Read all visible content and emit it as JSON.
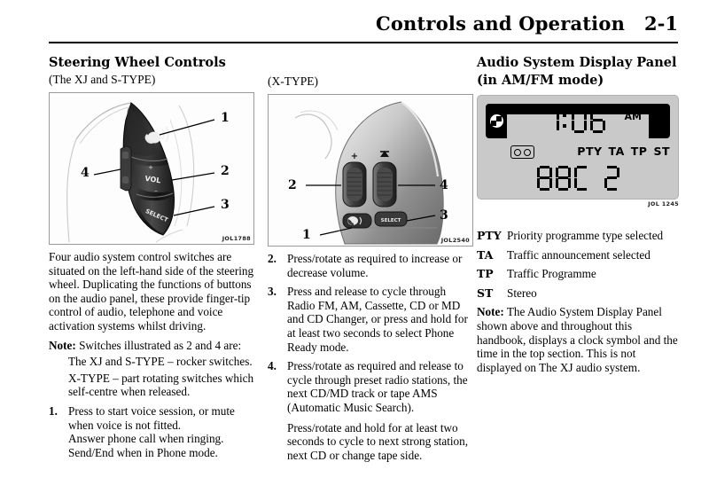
{
  "header": {
    "title": "Controls and Operation",
    "page": "2-1"
  },
  "left": {
    "section_title": "Steering Wheel Controls",
    "subtitle": "(The XJ and S-TYPE)",
    "figure": {
      "caption": "JOL1788",
      "callouts": [
        "1",
        "2",
        "3",
        "4"
      ],
      "button_labels": [
        "VOL",
        "SELECT"
      ]
    },
    "paragraph": "Four audio system control switches are situated on the left-hand side of the steering wheel. Duplicating the functions of buttons on the audio panel, these provide finger-tip control of audio, telephone and voice activation systems whilst driving.",
    "note_label": "Note:",
    "note_text": "Switches illustrated as 2 and 4 are:",
    "note_bold_a": "2",
    "note_bold_b": "4",
    "indent_1": "The XJ and S-TYPE – rocker switches.",
    "indent_2": "X-TYPE – part rotating switches which self-centre when released.",
    "item1_num": "1.",
    "item1_lines": [
      "Press to start voice session, or mute",
      "when voice is not fitted.",
      "Answer phone call when ringing.",
      "Send/End when in Phone mode."
    ]
  },
  "mid": {
    "subtitle": "(X-TYPE)",
    "figure": {
      "caption": "JOL2540",
      "callouts": [
        "1",
        "2",
        "3",
        "4"
      ]
    },
    "items": [
      {
        "num": "2.",
        "paragraphs": [
          "Press/rotate as required to increase or decrease volume."
        ]
      },
      {
        "num": "3.",
        "paragraphs": [
          "Press and release to cycle through Radio FM, AM, Cassette, CD or MD and CD Changer, or press and hold for at least two seconds to select Phone Ready mode."
        ]
      },
      {
        "num": "4.",
        "paragraphs": [
          "Press/rotate as required and release to cycle through preset radio stations, the next CD/MD track or tape AMS (Automatic Music Search).",
          "Press/rotate and hold for at least two seconds to cycle to next strong station, next CD or change tape side."
        ]
      }
    ]
  },
  "right": {
    "section_title_line1": "Audio System Display Panel",
    "section_title_line2": "(in AM/FM mode)",
    "display": {
      "time": "1:06",
      "time_digits": [
        "1",
        "0",
        "6"
      ],
      "meridiem": "AM",
      "clock_icon": "clock-icon",
      "cassette_icon": "cassette-icon",
      "flags": [
        "PTY",
        "TA",
        "TP",
        "ST"
      ],
      "station_text": "BBC 2",
      "station_digits": [
        "B",
        "B",
        "C",
        " ",
        "2"
      ],
      "caption": "JOL 1245"
    },
    "legend": [
      {
        "key": "PTY",
        "value": "Priority programme type selected"
      },
      {
        "key": "TA",
        "value": "Traffic announcement selected"
      },
      {
        "key": "TP",
        "value": "Traffic Programme"
      },
      {
        "key": "ST",
        "value": "Stereo"
      }
    ],
    "note_label": "Note:",
    "note_text": "The Audio System Display Panel shown above and throughout this handbook, displays a clock symbol and the time in the top section. This is not displayed on The XJ audio system."
  },
  "colors": {
    "ink": "#000000",
    "lcd_bg": "#c9c9c9",
    "figure_border": "#9a9a9a"
  }
}
